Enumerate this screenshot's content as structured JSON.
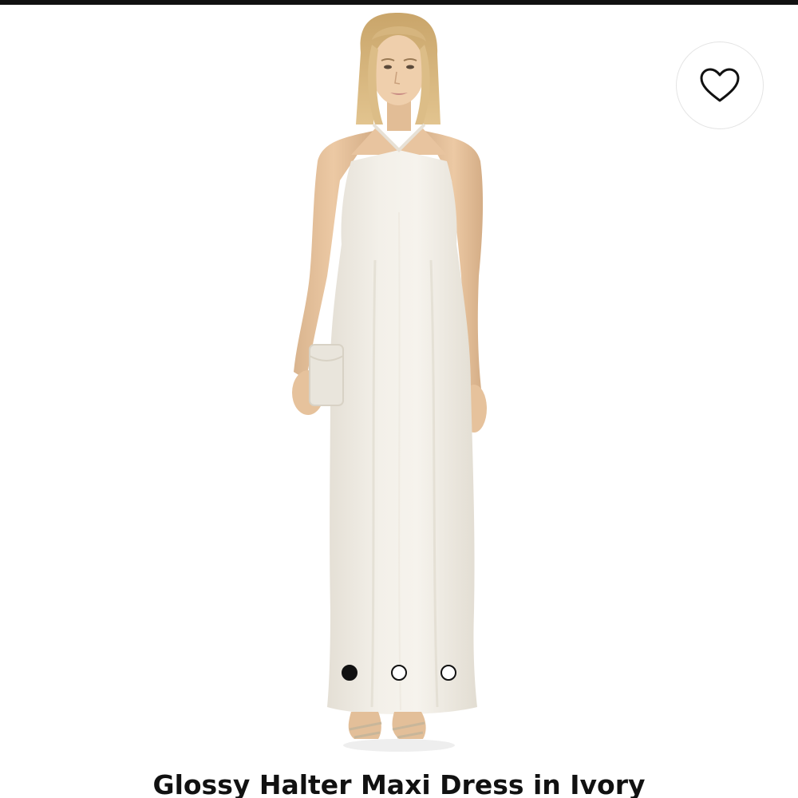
{
  "product": {
    "title": "Glossy Halter Maxi Dress in Ivory",
    "image_alt": "Model wearing ivory glossy halter maxi dress holding a clutch"
  },
  "gallery": {
    "image_count": 3,
    "active_index": 0
  },
  "wishlist": {
    "icon": "heart-outline-icon",
    "label": "Add to wishlist"
  },
  "colors": {
    "dress": "#efebe3",
    "accent": "#111111"
  }
}
